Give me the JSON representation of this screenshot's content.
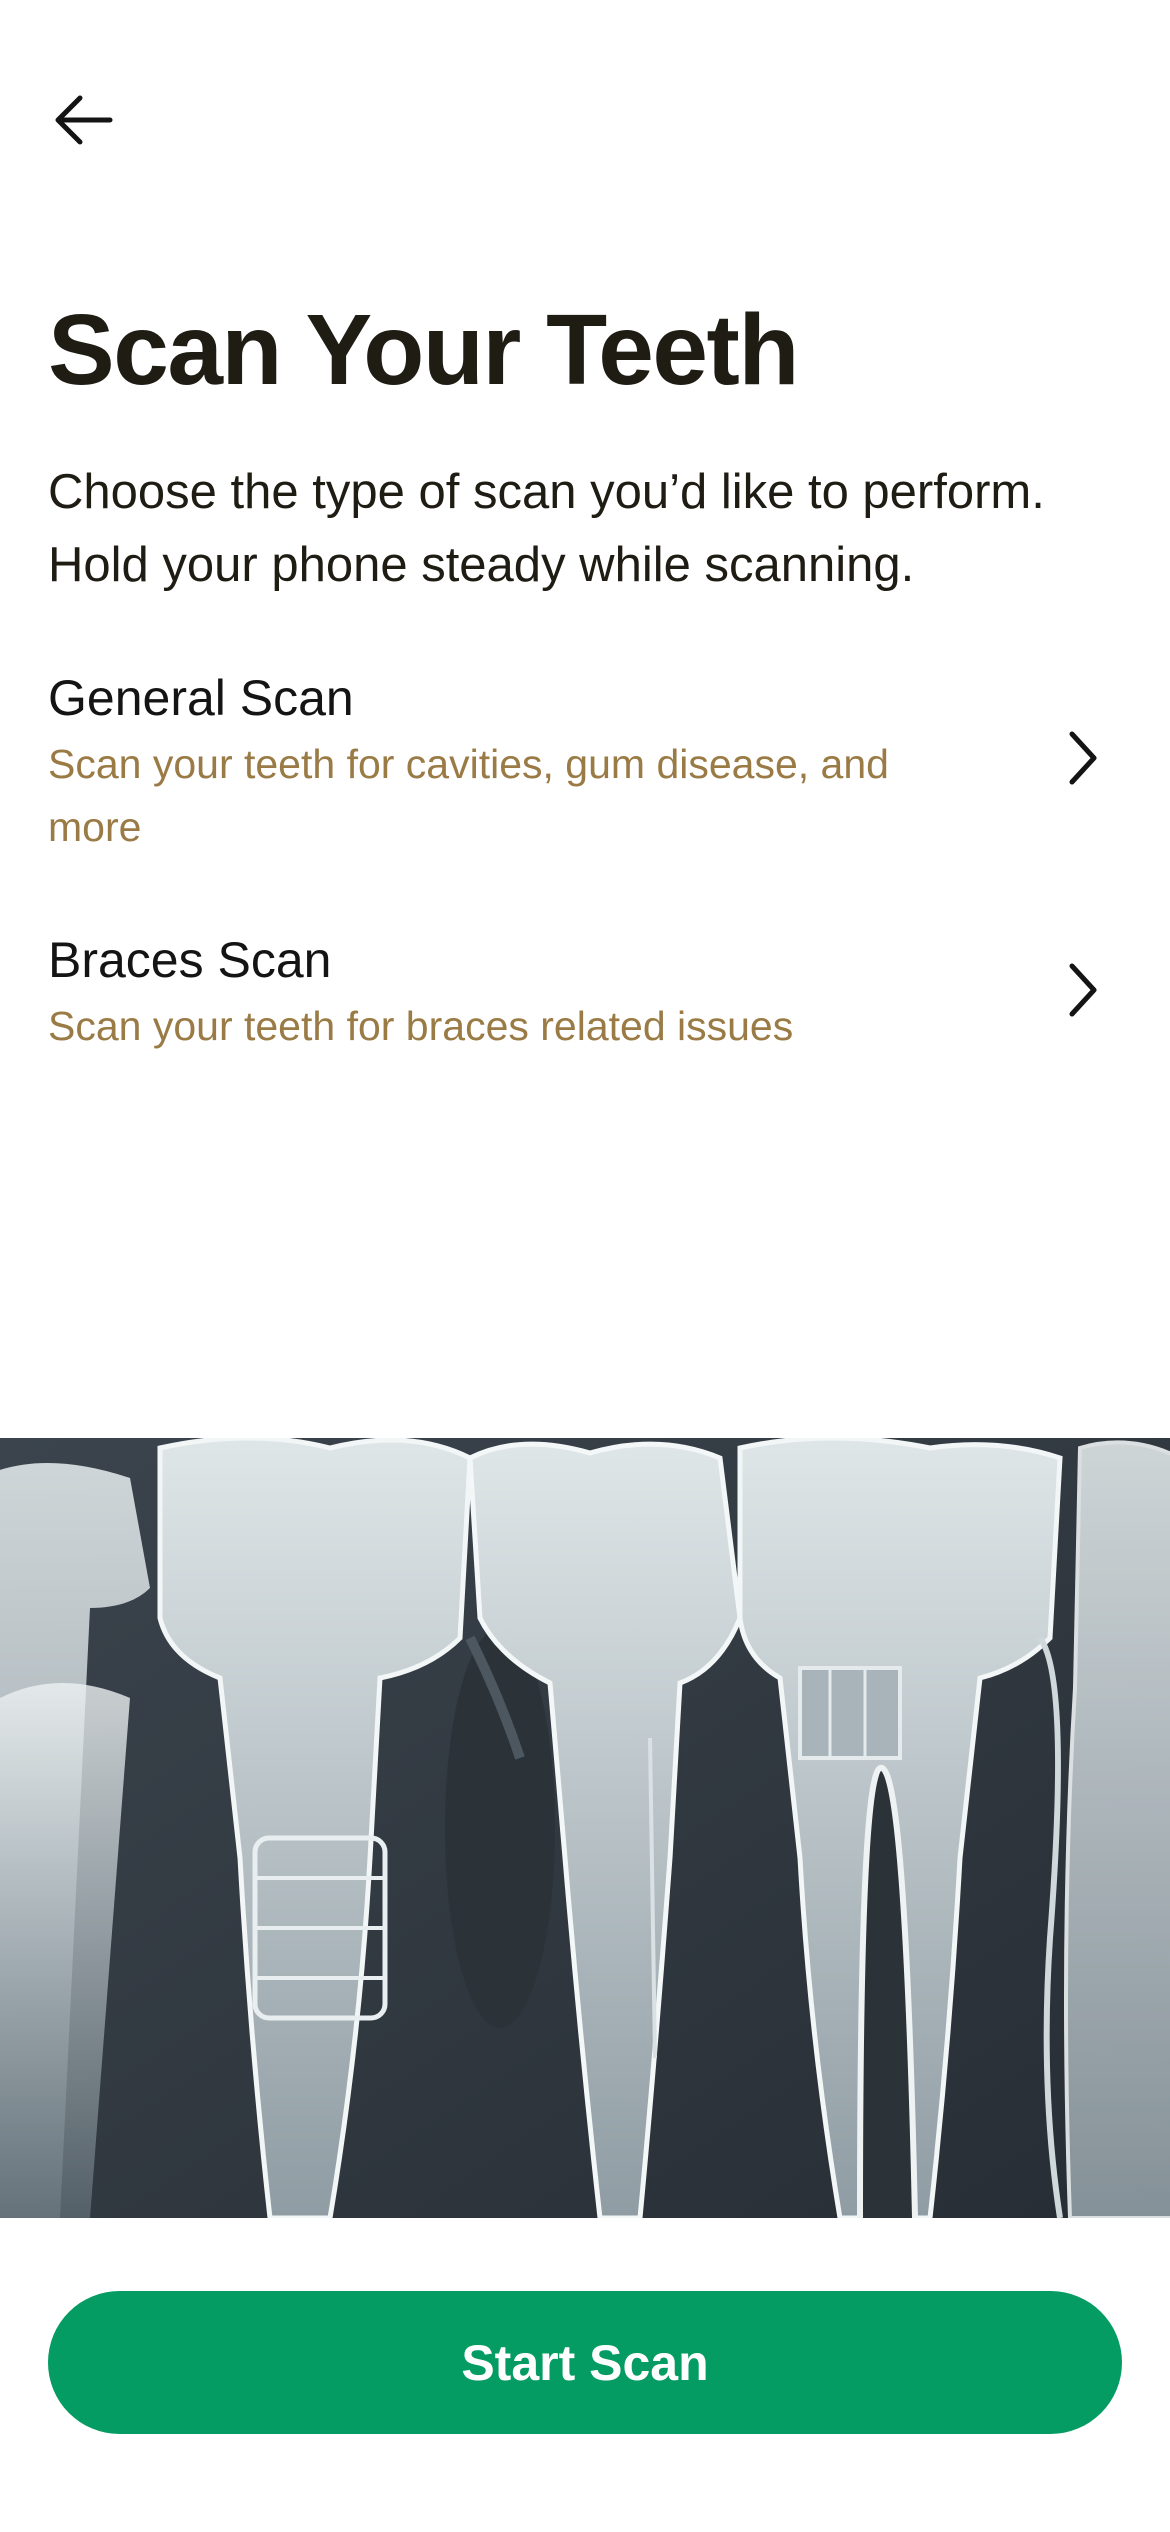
{
  "header": {
    "back_icon": "arrow-left-icon",
    "title": "Scan Your Teeth",
    "subtitle_line1": "Choose the type of scan you’d like to perform.",
    "subtitle_line2": "Hold your phone steady while scanning."
  },
  "options": [
    {
      "title": "General Scan",
      "description_line1": "Scan your teeth for cavities, gum disease, and",
      "description_line2": "more",
      "icon": "chevron-right-icon"
    },
    {
      "title": "Braces Scan",
      "description": "Scan your teeth for braces related issues",
      "icon": "chevron-right-icon"
    }
  ],
  "hero": {
    "image": "teeth-xray-illustration"
  },
  "footer": {
    "start_label": "Start Scan"
  },
  "colors": {
    "text_primary": "#1f1c14",
    "accent_description": "#9a7b45",
    "button_green": "#049c62",
    "hero_background": "#333b44"
  }
}
